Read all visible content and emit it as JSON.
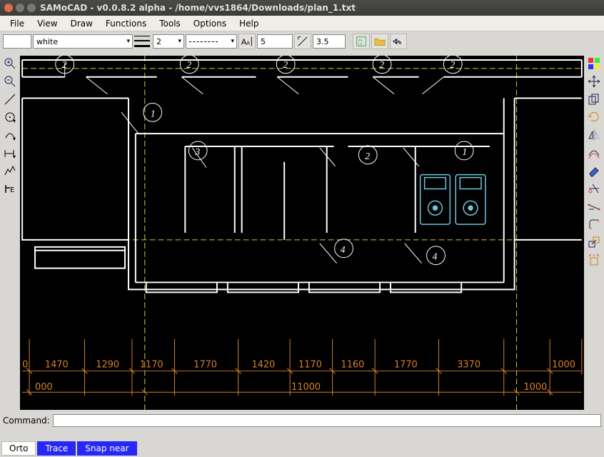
{
  "title": "SAMoCAD - v0.0.8.2 alpha - /home/vvs1864/Downloads/plan_1.txt",
  "menu": {
    "file": "File",
    "view": "View",
    "draw": "Draw",
    "functions": "Functions",
    "tools": "Tools",
    "options": "Options",
    "help": "Help"
  },
  "toolbar": {
    "color_name": "white",
    "line_width": "2",
    "font_size": "5",
    "scale": "3.5"
  },
  "command": {
    "label": "Command:"
  },
  "status": {
    "orto": "Orto",
    "trace": "Trace",
    "snap": "Snap near"
  },
  "markers": {
    "top": [
      "2",
      "2",
      "2",
      "2",
      "2"
    ],
    "row2": [
      "1"
    ],
    "row3": [
      "3",
      "2",
      "1"
    ],
    "row4": [
      "4",
      "4"
    ]
  },
  "dimensions": {
    "upper": [
      "0",
      "1470",
      "1290",
      "1170",
      "1770",
      "1420",
      "1170",
      "1160",
      "1770",
      "3370",
      "1000"
    ],
    "lower_left": "000",
    "lower_mid": "11000",
    "lower_right": "1000"
  }
}
